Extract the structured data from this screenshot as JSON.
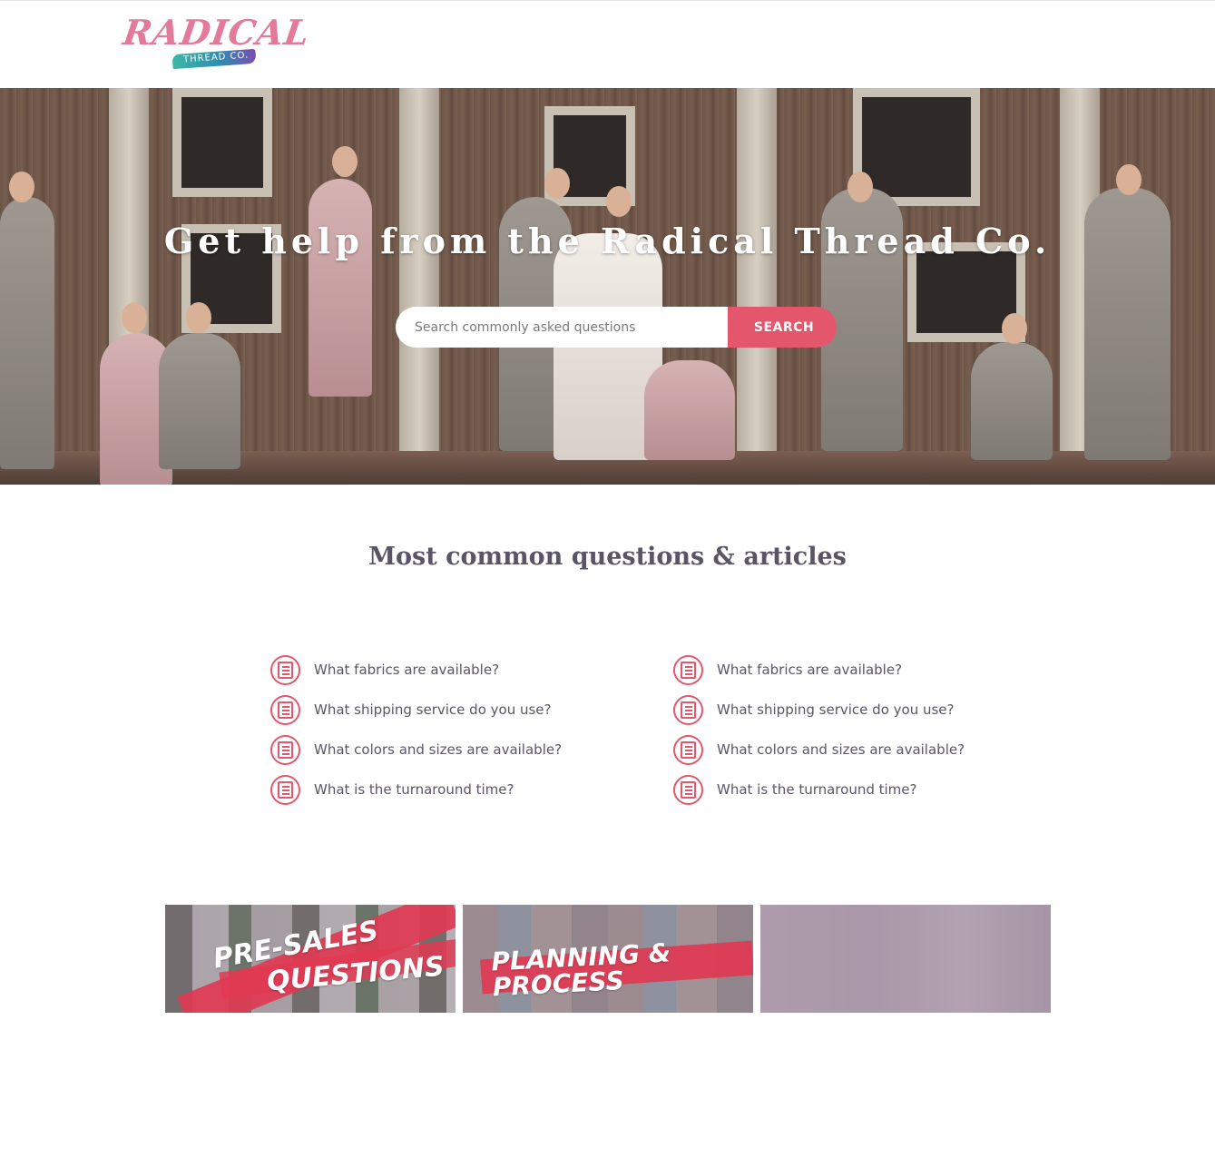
{
  "brand": {
    "logo_word": "RADICAL",
    "logo_sub": "THREAD CO."
  },
  "hero": {
    "title": "Get help from the Radical Thread Co.",
    "search": {
      "placeholder": "Search commonly asked questions",
      "value": "",
      "button_label": "SEARCH"
    }
  },
  "questions": {
    "section_title": "Most common questions & articles",
    "left": [
      {
        "label": "What fabrics are available?",
        "icon": "article-icon"
      },
      {
        "label": "What shipping service do you use?",
        "icon": "article-icon"
      },
      {
        "label": "What colors and sizes are available?",
        "icon": "article-icon"
      },
      {
        "label": "What is the turnaround time?",
        "icon": "article-icon"
      }
    ],
    "right": [
      {
        "label": "What fabrics are available?",
        "icon": "article-icon"
      },
      {
        "label": "What shipping service do you use?",
        "icon": "article-icon"
      },
      {
        "label": "What colors and sizes are available?",
        "icon": "article-icon"
      },
      {
        "label": "What is the turnaround time?",
        "icon": "article-icon"
      }
    ]
  },
  "categories": [
    {
      "line1": "PRE-SALES",
      "line2": "QUESTIONS"
    },
    {
      "line1": "PLANNING & PROCESS",
      "line2": ""
    },
    {
      "line1": "",
      "line2": ""
    }
  ],
  "colors": {
    "accent": "#e3566b",
    "text": "#5b5566",
    "brush_red": "#e03a52"
  }
}
